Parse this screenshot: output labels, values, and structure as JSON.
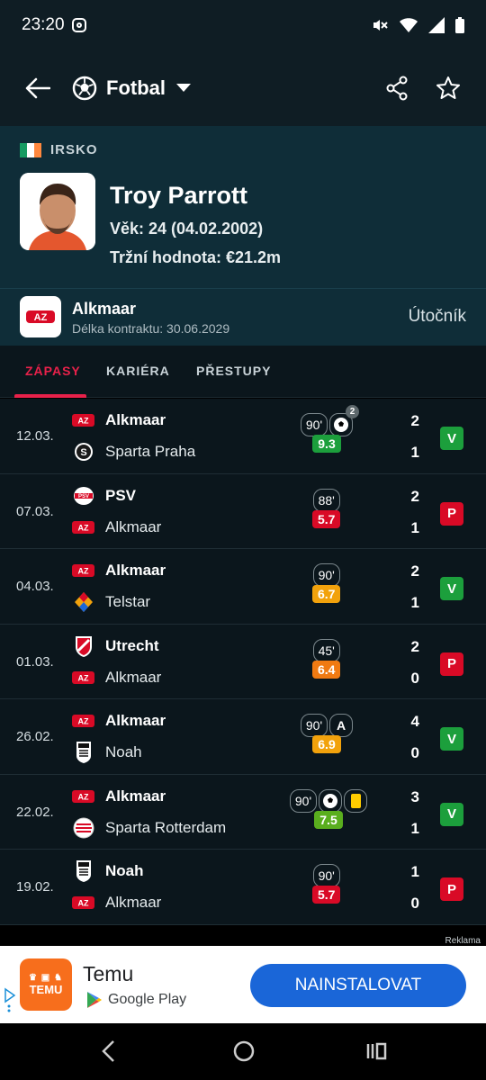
{
  "status_bar": {
    "time": "23:20"
  },
  "header": {
    "sport": "Fotbal"
  },
  "player": {
    "country": "IRSKO",
    "name": "Troy Parrott",
    "age": "Věk: 24 (04.02.2002)",
    "market_value": "Tržní hodnota: €21.2m"
  },
  "club": {
    "name": "Alkmaar",
    "contract": "Délka kontraktu: 30.06.2029",
    "position": "Útočník"
  },
  "tabs": [
    "ZÁPASY",
    "KARIÉRA",
    "PŘESTUPY"
  ],
  "matches": [
    {
      "date": "12.03.",
      "home": "Alkmaar",
      "away": "Sparta Praha",
      "home_score": "2",
      "away_score": "1",
      "result": "V",
      "minutes": "90'",
      "rating": "9.3",
      "rating_color": "#1c9f3c",
      "goals": "2"
    },
    {
      "date": "07.03.",
      "home": "PSV",
      "away": "Alkmaar",
      "home_score": "2",
      "away_score": "1",
      "result": "P",
      "minutes": "88'",
      "rating": "5.7",
      "rating_color": "#d90a26"
    },
    {
      "date": "04.03.",
      "home": "Alkmaar",
      "away": "Telstar",
      "home_score": "2",
      "away_score": "1",
      "result": "V",
      "minutes": "90'",
      "rating": "6.7",
      "rating_color": "#f2a20c"
    },
    {
      "date": "01.03.",
      "home": "Utrecht",
      "away": "Alkmaar",
      "home_score": "2",
      "away_score": "0",
      "result": "P",
      "minutes": "45'",
      "rating": "6.4",
      "rating_color": "#f07a12"
    },
    {
      "date": "26.02.",
      "home": "Alkmaar",
      "away": "Noah",
      "home_score": "4",
      "away_score": "0",
      "result": "V",
      "minutes": "90'",
      "assist": "A",
      "rating": "6.9",
      "rating_color": "#f2a20c"
    },
    {
      "date": "22.02.",
      "home": "Alkmaar",
      "away": "Sparta Rotterdam",
      "home_score": "3",
      "away_score": "1",
      "result": "V",
      "minutes": "90'",
      "rating": "7.5",
      "rating_color": "#5aae1e"
    },
    {
      "date": "19.02.",
      "home": "Noah",
      "away": "Alkmaar",
      "home_score": "1",
      "away_score": "0",
      "result": "P",
      "minutes": "90'",
      "rating": "5.7",
      "rating_color": "#d90a26"
    }
  ],
  "ad": {
    "label": "Reklama",
    "app_name": "Temu",
    "logo_text": "TEMU",
    "store": "Google Play",
    "button": "NAINSTALOVAT"
  },
  "colors": {
    "win": "#1c9f3c",
    "loss": "#d90a26",
    "accent": "#e8214a"
  }
}
